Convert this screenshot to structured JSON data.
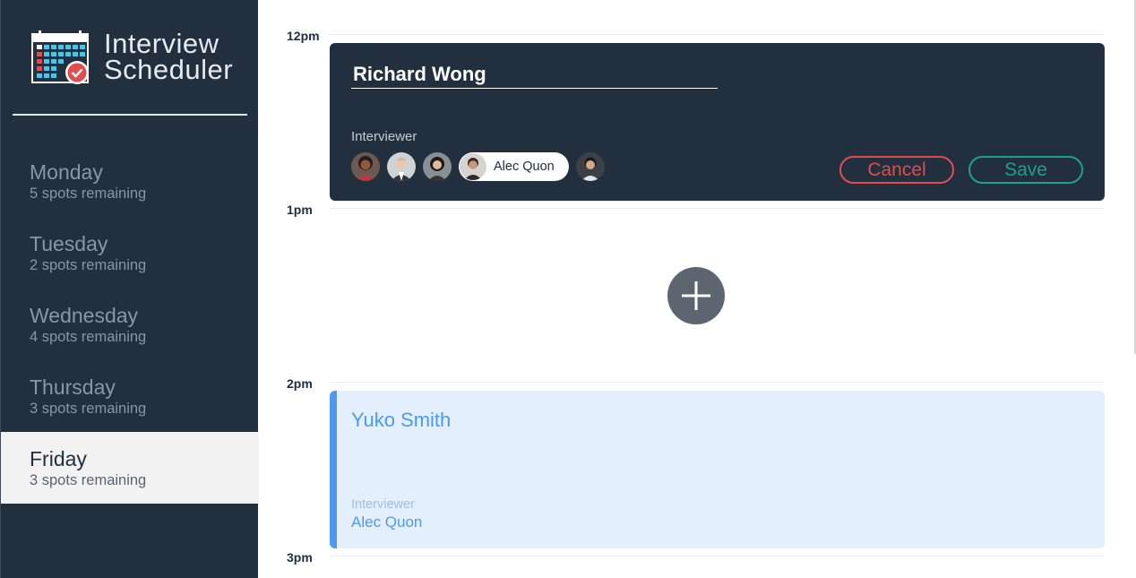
{
  "app": {
    "title_line1": "Interview",
    "title_line2": "Scheduler"
  },
  "sidebar": {
    "days": [
      {
        "name": "Monday",
        "spots": "5 spots remaining",
        "selected": false
      },
      {
        "name": "Tuesday",
        "spots": "2 spots remaining",
        "selected": false
      },
      {
        "name": "Wednesday",
        "spots": "4 spots remaining",
        "selected": false
      },
      {
        "name": "Thursday",
        "spots": "3 spots remaining",
        "selected": false
      },
      {
        "name": "Friday",
        "spots": "3 spots remaining",
        "selected": true
      }
    ]
  },
  "schedule": {
    "times": [
      "12pm",
      "1pm",
      "2pm",
      "3pm"
    ]
  },
  "form": {
    "student_value": "Richard Wong",
    "interviewer_heading": "Interviewer",
    "selected_interviewer": "Alec Quon",
    "cancel_label": "Cancel",
    "save_label": "Save"
  },
  "appointment": {
    "student": "Yuko Smith",
    "interviewer_heading": "Interviewer",
    "interviewer": "Alec Quon"
  },
  "colors": {
    "sidebar_bg": "#222f3e",
    "cancel": "#e14d4d",
    "save": "#1ea285",
    "accent_blue": "#4c9aef"
  }
}
